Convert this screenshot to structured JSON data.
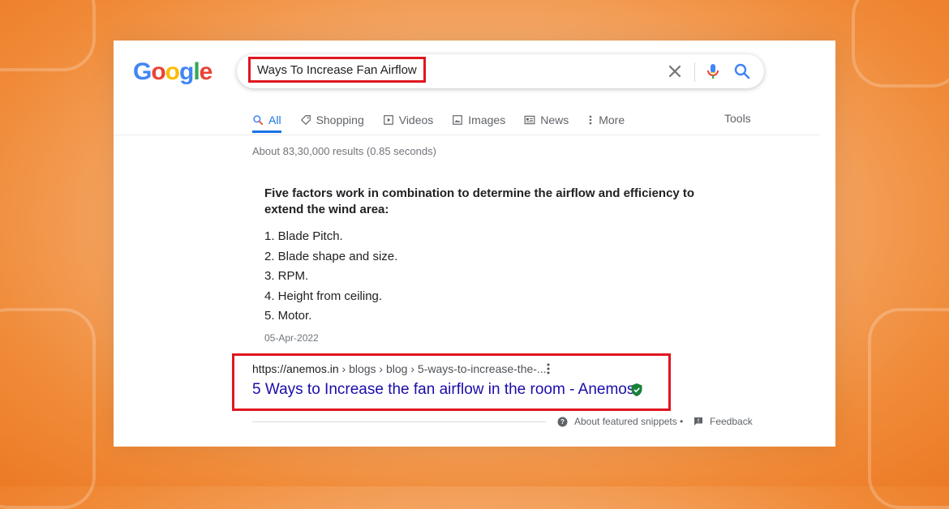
{
  "logo": {
    "letters": [
      "G",
      "o",
      "o",
      "g",
      "l",
      "e"
    ],
    "colors": [
      "#4285F4",
      "#EA4335",
      "#FBBC05",
      "#4285F4",
      "#34A853",
      "#EA4335"
    ]
  },
  "search": {
    "query": "Ways To Increase Fan Airflow",
    "icons": [
      "close-icon",
      "mic-icon",
      "search-icon"
    ]
  },
  "tabs": [
    {
      "label": "All",
      "icon": "search-icon",
      "active": true
    },
    {
      "label": "Shopping",
      "icon": "tag-icon"
    },
    {
      "label": "Videos",
      "icon": "play-icon"
    },
    {
      "label": "Images",
      "icon": "image-icon"
    },
    {
      "label": "News",
      "icon": "news-icon"
    },
    {
      "label": "More",
      "icon": "more-vertical-icon"
    }
  ],
  "tools_label": "Tools",
  "result_stats": "About 83,30,000 results (0.85 seconds)",
  "snippet": {
    "heading": "Five factors work in combination to determine the airflow and efficiency to extend the wind area:",
    "items": [
      "1. Blade Pitch.",
      "2. Blade shape and size.",
      "3. RPM.",
      "4. Height from ceiling.",
      "5. Motor."
    ],
    "date": "05-Apr-2022"
  },
  "result": {
    "url_domain": "https://anemos.in",
    "url_path": " › blogs › blog › 5-ways-to-increase-the-...",
    "title": "5 Ways to Increase the fan airflow in the room - Anemos"
  },
  "footer": {
    "about": "About featured snippets",
    "separator": "•",
    "feedback": "Feedback"
  },
  "colors": {
    "highlight": "#e0161f",
    "link": "#1a0dab",
    "accent": "#1a73e8",
    "background": "#ef8a36"
  }
}
